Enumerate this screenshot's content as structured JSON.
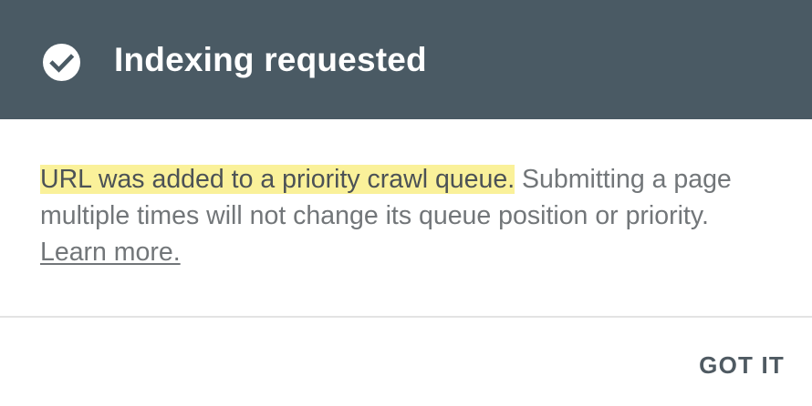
{
  "header": {
    "icon": "check-circle-icon",
    "title": "Indexing requested",
    "background_color": "#4a5a64"
  },
  "message": {
    "highlighted_text": "URL was added to a priority crawl queue.",
    "body_text": " Submitting a page multiple times will not change its queue position or priority.",
    "link_label": "Learn more.",
    "highlight_color": "#faf19a"
  },
  "actions": {
    "dismiss_label": "GOT IT"
  }
}
